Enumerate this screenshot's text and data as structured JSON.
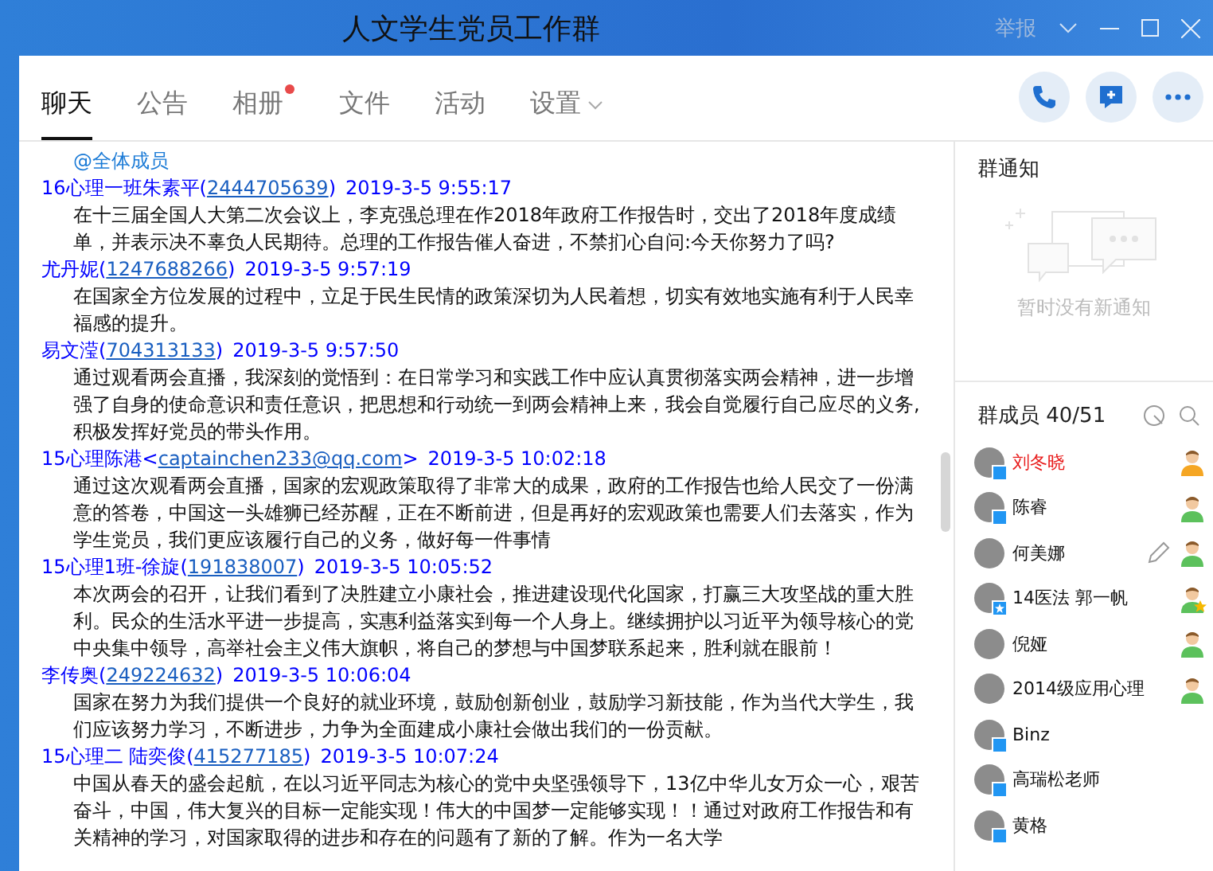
{
  "window": {
    "title": "人文学生党员工作群",
    "report": "举报"
  },
  "tabs": [
    {
      "label": "聊天",
      "selected": true,
      "kind": "plain"
    },
    {
      "label": "公告",
      "selected": false,
      "kind": "plain"
    },
    {
      "label": "相册",
      "selected": false,
      "kind": "dot"
    },
    {
      "label": "文件",
      "selected": false,
      "kind": "plain"
    },
    {
      "label": "活动",
      "selected": false,
      "kind": "plain"
    },
    {
      "label": "设置",
      "selected": false,
      "kind": "dropdown"
    }
  ],
  "chat": {
    "mention": "@全体成员",
    "messages": [
      {
        "sender": "16心理一班朱素平",
        "open": "(",
        "contact": "2444705639",
        "close": ")",
        "time": "2019-3-5 9:55:17",
        "body": "在十三届全国人大第二次会议上，李克强总理在作2018年政府工作报告时，交出了2018年度成绩单，并表示决不辜负人民期待。总理的工作报告催人奋进，不禁扪心自问:今天你努力了吗?"
      },
      {
        "sender": "尤丹妮",
        "open": "(",
        "contact": "1247688266",
        "close": ")",
        "time": "2019-3-5 9:57:19",
        "body": "在国家全方位发展的过程中，立足于民生民情的政策深切为人民着想，切实有效地实施有利于人民幸福感的提升。"
      },
      {
        "sender": "易文滢",
        "open": "(",
        "contact": "704313133",
        "close": ")",
        "time": "2019-3-5 9:57:50",
        "body": "通过观看两会直播，我深刻的觉悟到：在日常学习和实践工作中应认真贯彻落实两会精神，进一步增强了自身的使命意识和责任意识，把思想和行动统一到两会精神上来，我会自觉履行自己应尽的义务,积极发挥好党员的带头作用。"
      },
      {
        "sender": "15心理陈港",
        "open": "<",
        "contact": "captainchen233@qq.com",
        "close": ">",
        "time": "2019-3-5 10:02:18",
        "body": "通过这次观看两会直播，国家的宏观政策取得了非常大的成果，政府的工作报告也给人民交了一份满意的答卷，中国这一头雄狮已经苏醒，正在不断前进，但是再好的宏观政策也需要人们去落实，作为学生党员，我们更应该履行自己的义务，做好每一件事情"
      },
      {
        "sender": "15心理1班-徐旋",
        "open": "(",
        "contact": "191838007",
        "close": ")",
        "time": "2019-3-5 10:05:52",
        "body": "本次两会的召开，让我们看到了决胜建立小康社会，推进建设现代化国家，打赢三大攻坚战的重大胜利。民众的生活水平进一步提高，实惠利益落实到每一个人身上。继续拥护以习近平为领导核心的党中央集中领导，高举社会主义伟大旗帜，将自己的梦想与中国梦联系起来，胜利就在眼前！"
      },
      {
        "sender": "李传奥",
        "open": "(",
        "contact": "249224632",
        "close": ")",
        "time": "2019-3-5 10:06:04",
        "body": "国家在努力为我们提供一个良好的就业环境，鼓励创新创业，鼓励学习新技能，作为当代大学生，我们应该努力学习，不断进步，力争为全面建成小康社会做出我们的一份贡献。"
      },
      {
        "sender": "15心理二 陆奕俊",
        "open": "(",
        "contact": "415277185",
        "close": ")",
        "time": "2019-3-5 10:07:24",
        "body": "中国从春天的盛会起航，在以习近平同志为核心的党中央坚强领导下，13亿中华儿女万众一心，艰苦奋斗，中国，伟大复兴的目标一定能实现！伟大的中国梦一定能够实现！！通过对政府工作报告和有关精神的学习，对国家取得的进步和存在的问题有了新的了解。作为一名大学"
      }
    ]
  },
  "notice": {
    "title": "群通知",
    "empty_text": "暂时没有新通知"
  },
  "members": {
    "title": "群成员 40/51",
    "items": [
      {
        "name": "刘冬晓",
        "owner": true,
        "admin": false,
        "starred": false,
        "device": true,
        "vip": false,
        "edit": false
      },
      {
        "name": "陈睿",
        "owner": false,
        "admin": true,
        "starred": false,
        "device": true,
        "vip": false,
        "edit": false
      },
      {
        "name": "何美娜",
        "owner": false,
        "admin": true,
        "starred": false,
        "device": false,
        "vip": false,
        "edit": true
      },
      {
        "name": "14医法 郭一帆",
        "owner": false,
        "admin": true,
        "starred": true,
        "device": false,
        "vip": true,
        "edit": false
      },
      {
        "name": "倪娅",
        "owner": false,
        "admin": true,
        "starred": false,
        "device": false,
        "vip": false,
        "edit": false
      },
      {
        "name": "2014级应用心理",
        "owner": false,
        "admin": true,
        "starred": false,
        "device": false,
        "vip": false,
        "edit": false
      },
      {
        "name": "Binz",
        "owner": false,
        "admin": false,
        "starred": false,
        "device": true,
        "vip": false,
        "edit": false
      },
      {
        "name": "高瑞松老师",
        "owner": false,
        "admin": false,
        "starred": false,
        "device": true,
        "vip": false,
        "edit": false
      },
      {
        "name": "黄格",
        "owner": false,
        "admin": false,
        "starred": false,
        "device": true,
        "vip": false,
        "edit": false
      }
    ]
  }
}
